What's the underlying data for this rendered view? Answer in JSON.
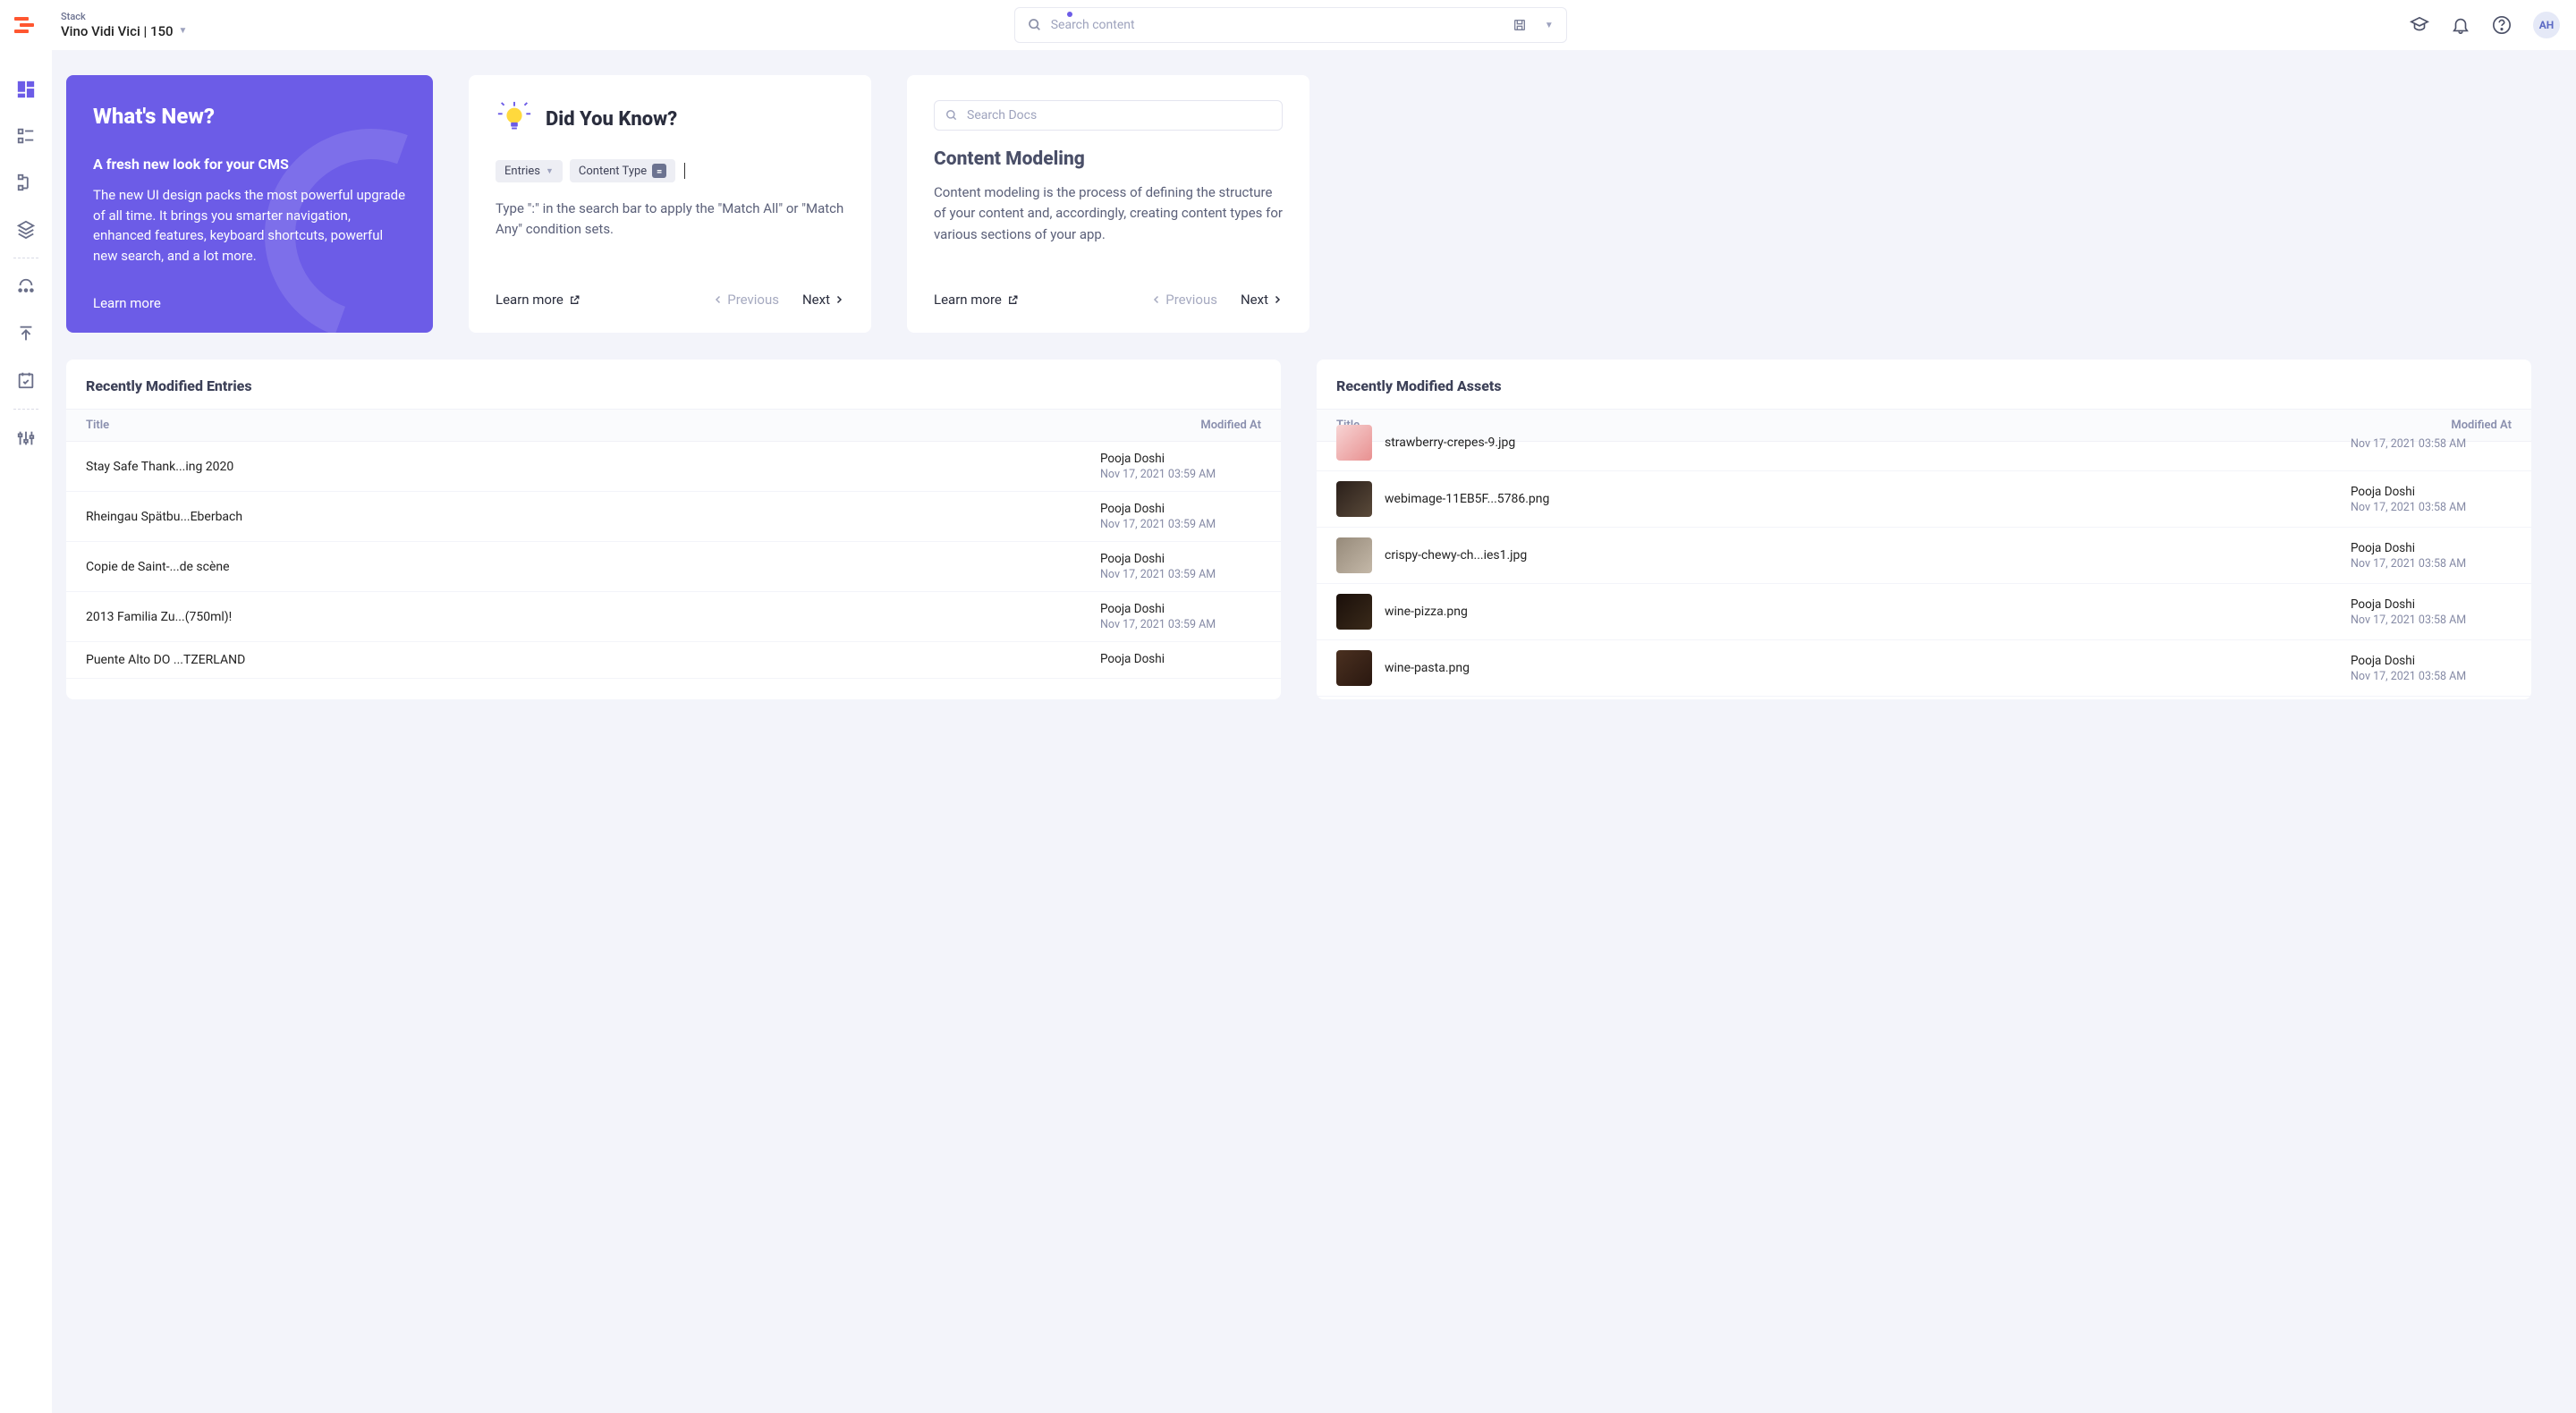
{
  "header": {
    "stack_label": "Stack",
    "stack_name": "Vino Vidi Vici | 150",
    "search_placeholder": "Search content",
    "avatar": "AH"
  },
  "whatsnew": {
    "title": "What's New?",
    "subtitle": "A fresh new look for your CMS",
    "body": "The new UI design packs the most powerful upgrade of all time. It brings you smarter navigation, enhanced features, keyboard shortcuts, powerful new search, and a lot more.",
    "learn_more": "Learn more"
  },
  "dyk": {
    "title": "Did You Know?",
    "chip_entries": "Entries",
    "chip_ct": "Content Type",
    "body": "Type \":\" in the search bar to apply the \"Match All\" or \"Match Any\" condition sets.",
    "learn_more": "Learn more",
    "prev": "Previous",
    "next": "Next"
  },
  "modeling": {
    "search_placeholder": "Search Docs",
    "title": "Content Modeling",
    "body": "Content modeling is the process of defining the structure of your content and, accordingly, creating content types for various sections of your app.",
    "learn_more": "Learn more",
    "prev": "Previous",
    "next": "Next"
  },
  "entries_table": {
    "title": "Recently Modified Entries",
    "col_title": "Title",
    "col_modified": "Modified At",
    "rows": [
      {
        "title": "Stay Safe Thank...ing 2020",
        "by": "Pooja Doshi",
        "ts": "Nov 17, 2021 03:59 AM"
      },
      {
        "title": "Rheingau Spätbu...Eberbach",
        "by": "Pooja Doshi",
        "ts": "Nov 17, 2021 03:59 AM"
      },
      {
        "title": "Copie de Saint-...de scène",
        "by": "Pooja Doshi",
        "ts": "Nov 17, 2021 03:59 AM"
      },
      {
        "title": "2013 Familia Zu...(750ml)!",
        "by": "Pooja Doshi",
        "ts": "Nov 17, 2021 03:59 AM"
      },
      {
        "title": "Puente Alto DO ...TZERLAND",
        "by": "Pooja Doshi",
        "ts": ""
      }
    ]
  },
  "assets_table": {
    "title": "Recently Modified Assets",
    "col_title": "Title",
    "col_modified": "Modified At",
    "rows": [
      {
        "title": "strawberry-crepes-9.jpg",
        "by": "",
        "ts": "Nov 17, 2021 03:58 AM",
        "thumb": "t1"
      },
      {
        "title": "webimage-11EB5F...5786.png",
        "by": "Pooja Doshi",
        "ts": "Nov 17, 2021 03:58 AM",
        "thumb": "t2"
      },
      {
        "title": "crispy-chewy-ch...ies1.jpg",
        "by": "Pooja Doshi",
        "ts": "Nov 17, 2021 03:58 AM",
        "thumb": "t3"
      },
      {
        "title": "wine-pizza.png",
        "by": "Pooja Doshi",
        "ts": "Nov 17, 2021 03:58 AM",
        "thumb": "t4"
      },
      {
        "title": "wine-pasta.png",
        "by": "Pooja Doshi",
        "ts": "Nov 17, 2021 03:58 AM",
        "thumb": "t5"
      }
    ]
  }
}
